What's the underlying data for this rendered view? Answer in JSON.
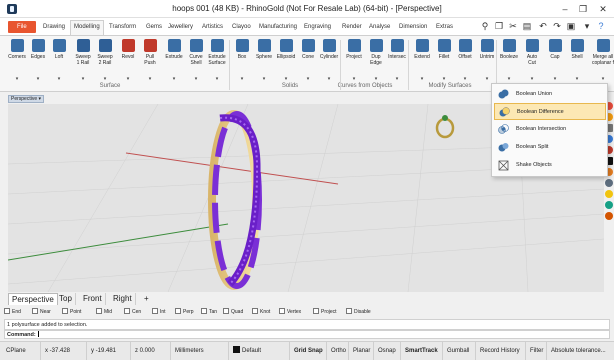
{
  "window": {
    "title": "hoops 001 (48 KB) - RhinoGold (Not For Resale Lab) (64-bit) - [Perspective]",
    "minimize": "–",
    "maximize": "❐",
    "close": "✕"
  },
  "ribbon_tabs": [
    "File",
    "Drawing",
    "Modelling",
    "Transform",
    "Gems",
    "Jewellery",
    "Artistics",
    "Clayoo",
    "Manufacturing",
    "Engraving",
    "Render",
    "Analyse",
    "Dimension",
    "Extras"
  ],
  "active_tab": "Modelling",
  "ribbon": {
    "tools": [
      {
        "label": "Corners",
        "icon": "corners-icon"
      },
      {
        "label": "Edges",
        "icon": "edges-icon"
      },
      {
        "label": "Loft",
        "icon": "loft-icon"
      },
      {
        "label": "Sweep\n1 Rail",
        "icon": "sweep1-icon"
      },
      {
        "label": "Sweep\n2 Rail",
        "icon": "sweep2-icon"
      },
      {
        "label": "Revol",
        "icon": "revolve-icon"
      },
      {
        "label": "Pull\nPush",
        "icon": "pullpush-icon"
      },
      {
        "label": "Extrude",
        "icon": "extrude-icon"
      },
      {
        "label": "Curve\nShell",
        "icon": "curveshell-icon"
      },
      {
        "label": "Extrude\nSurface",
        "icon": "extrude-surface-icon"
      },
      {
        "label": "Box",
        "icon": "box-icon"
      },
      {
        "label": "Sphere",
        "icon": "sphere-icon"
      },
      {
        "label": "Ellipsoid",
        "icon": "ellipsoid-icon"
      },
      {
        "label": "Cone",
        "icon": "cone-icon"
      },
      {
        "label": "Cylinder",
        "icon": "cylinder-icon"
      },
      {
        "label": "Project",
        "icon": "project-icon"
      },
      {
        "label": "Dup\nEdge",
        "icon": "dupedge-icon"
      },
      {
        "label": "Intersec",
        "icon": "intersect-icon"
      },
      {
        "label": "Extend",
        "icon": "extend-icon"
      },
      {
        "label": "Fillet",
        "icon": "fillet-icon"
      },
      {
        "label": "Offset",
        "icon": "offset-icon"
      },
      {
        "label": "Untrim",
        "icon": "untrim-icon"
      },
      {
        "label": "Booleze",
        "icon": "boolean-icon"
      },
      {
        "label": "Auto\nCut",
        "icon": "autocut-icon"
      },
      {
        "label": "Cap",
        "icon": "cap-icon"
      },
      {
        "label": "Shell",
        "icon": "shell-icon"
      },
      {
        "label": "Merge all\ncoplanar faces",
        "icon": "merge-faces-icon"
      }
    ],
    "groups": [
      "Surface",
      "Solids",
      "Curves from Objects",
      "Modify Surfaces"
    ]
  },
  "dropdown": {
    "items": [
      "Boolean Union",
      "Boolean Difference",
      "Boolean Intersection",
      "Boolean Split",
      "Shake Objects"
    ],
    "highlighted": "Boolean Difference"
  },
  "viewport": {
    "label": "Perspective",
    "tabs": [
      "Perspective",
      "Top",
      "Front",
      "Right"
    ],
    "add_tab": "+"
  },
  "osnap": [
    "End",
    "Near",
    "Point",
    "Mid",
    "Cen",
    "Int",
    "Perp",
    "Tan",
    "Quad",
    "Knot",
    "Vertex",
    "Project",
    "Disable"
  ],
  "command": {
    "history": "1 polysurface added to selection.",
    "prompt": "Command:"
  },
  "status_bar": {
    "cplane": "CPlane",
    "x": "x -37.428",
    "y": "y -19.481",
    "z": "z 0.000",
    "units": "Millimeters",
    "layer": "Default",
    "grid_snap": "Grid Snap",
    "ortho": "Ortho",
    "planar": "Planar",
    "osnap": "Osnap",
    "smarttrack": "SmartTrack",
    "gumball": "Gumball",
    "record_history": "Record History",
    "filter": "Filter",
    "tolerance": "Absolute tolerance..."
  },
  "colors": {
    "file_tab": "#e8552f",
    "ring_purple": "#7a2fd6",
    "highlight": "#fce8b4",
    "axis_red": "#c05050",
    "axis_green": "#3c8c3c"
  }
}
